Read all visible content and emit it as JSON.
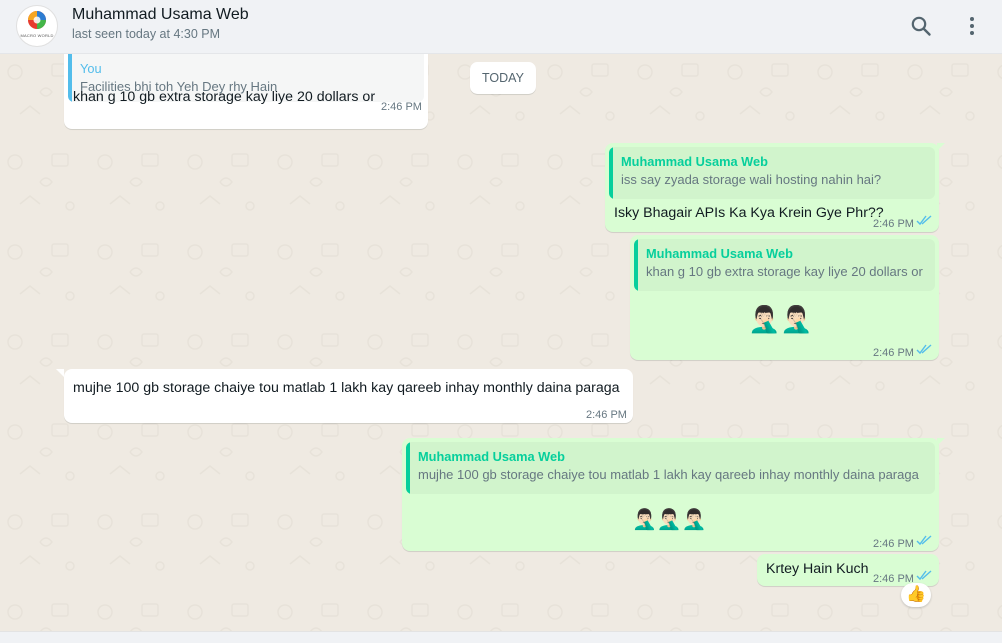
{
  "header": {
    "contact_name": "Muhammad Usama Web",
    "status": "last seen today at 4:30 PM",
    "avatar_text": "MACRO WORLD",
    "search_icon": "search-icon",
    "menu_icon": "kebab-menu-icon"
  },
  "chat": {
    "date_divider": "TODAY",
    "messages": [
      {
        "direction": "incoming",
        "quote_author": "You",
        "quote_text": "Facilities bhi toh Yeh Dey rhy Hain",
        "text": "khan g 10 gb extra storage kay liye 20 dollars or",
        "time": "2:46 PM"
      },
      {
        "direction": "outgoing",
        "quote_author": "Muhammad Usama Web",
        "quote_text": "iss say zyada storage wali hosting nahin hai?",
        "text": "Isky Bhagair APIs Ka Kya Krein Gye Phr??",
        "time": "2:46 PM",
        "status": "read"
      },
      {
        "direction": "outgoing",
        "quote_author": "Muhammad Usama Web",
        "quote_text": "khan g 10 gb extra storage kay liye 20 dollars or",
        "emoji": "🤦🏻‍♂️🤦🏻‍♂️",
        "time": "2:46 PM",
        "status": "read"
      },
      {
        "direction": "incoming",
        "text": "mujhe 100 gb storage chaiye tou matlab 1 lakh kay qareeb inhay monthly daina paraga",
        "time": "2:46 PM"
      },
      {
        "direction": "outgoing",
        "quote_author": "Muhammad Usama Web",
        "quote_text": "mujhe 100 gb storage chaiye tou matlab 1 lakh kay qareeb inhay monthly daina paraga",
        "emoji": "🤦🏻‍♂️🤦🏻‍♂️🤦🏻‍♂️",
        "time": "2:46 PM",
        "status": "read"
      },
      {
        "direction": "outgoing",
        "text": "Krtey Hain Kuch",
        "time": "2:46 PM",
        "status": "read",
        "reaction": "👍"
      }
    ]
  },
  "colors": {
    "incoming_bubble": "#ffffff",
    "outgoing_bubble": "#d9fdd3",
    "quote_author_other": "#06cf9c",
    "quote_author_you": "#53bdeb",
    "read_ticks": "#53bdeb",
    "chat_background": "#efeae2"
  }
}
